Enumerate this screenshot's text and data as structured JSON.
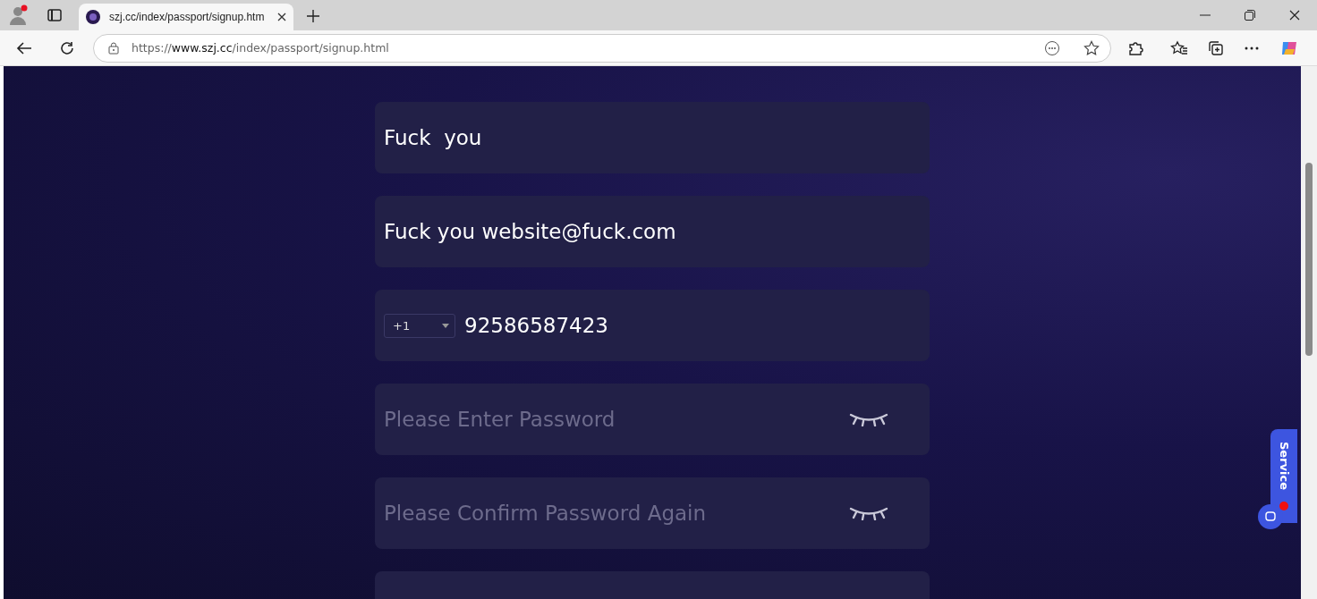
{
  "browser": {
    "tab": {
      "title": "szj.cc/index/passport/signup.htm"
    },
    "address": {
      "scheme": "https://",
      "host": "www.szj.cc",
      "path": "/index/passport/signup.html"
    }
  },
  "form": {
    "fields": [
      {
        "kind": "text",
        "value": "Fuck  you"
      },
      {
        "kind": "text",
        "value": "Fuck you website@fuck.com"
      },
      {
        "kind": "phone",
        "country_code": "+1",
        "value": "92586587423"
      },
      {
        "kind": "password",
        "placeholder": "Please Enter Password"
      },
      {
        "kind": "password",
        "placeholder": "Please Confirm Password Again"
      },
      {
        "kind": "blank"
      }
    ]
  },
  "service_button": {
    "label": "Service",
    "unread": true
  }
}
